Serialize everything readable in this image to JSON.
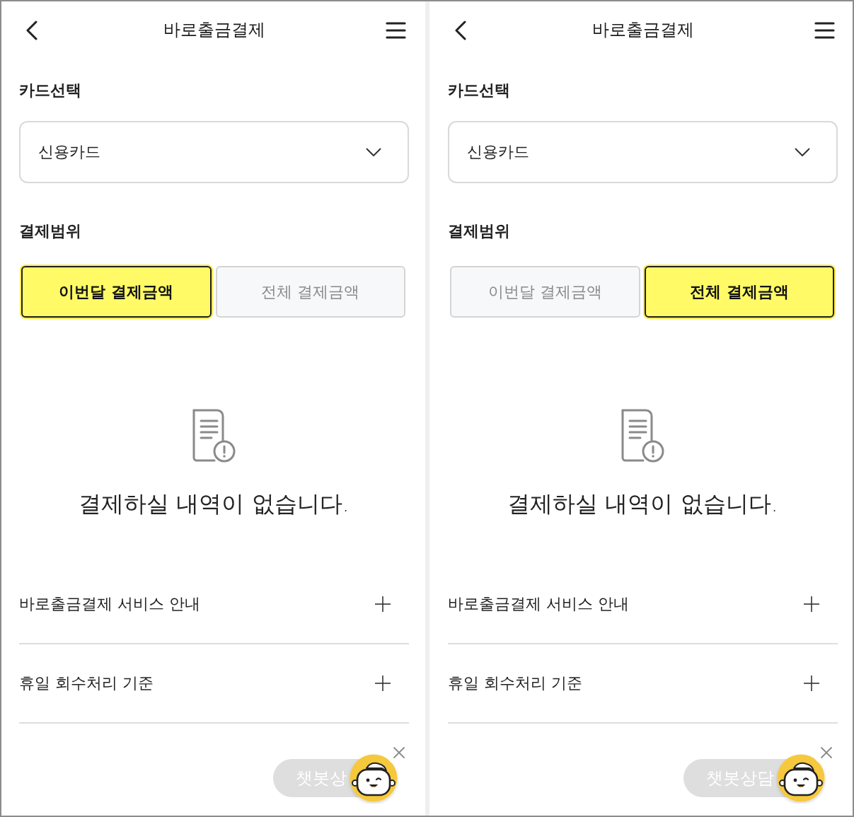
{
  "screens": [
    {
      "header": {
        "title": "바로출금결제"
      },
      "card_select": {
        "label": "카드선택",
        "value": "신용카드"
      },
      "payment_range": {
        "label": "결제범위",
        "options": [
          {
            "label": "이번달 결제금액",
            "selected": true
          },
          {
            "label": "전체 결제금액",
            "selected": false
          }
        ]
      },
      "empty_state": {
        "message": "결제하실 내역이 없습니다."
      },
      "accordion": [
        {
          "title": "바로출금결제 서비스 안내",
          "expanded": false
        },
        {
          "title": "휴일 회수처리 기준",
          "expanded": false
        }
      ],
      "chatbot": {
        "label": "챗봇상"
      }
    },
    {
      "header": {
        "title": "바로출금결제"
      },
      "card_select": {
        "label": "카드선택",
        "value": "신용카드"
      },
      "payment_range": {
        "label": "결제범위",
        "options": [
          {
            "label": "이번달 결제금액",
            "selected": false
          },
          {
            "label": "전체 결제금액",
            "selected": true
          }
        ]
      },
      "empty_state": {
        "message": "결제하실 내역이 없습니다."
      },
      "accordion": [
        {
          "title": "바로출금결제 서비스 안내",
          "expanded": false
        },
        {
          "title": "휴일 회수처리 기준",
          "expanded": false
        }
      ],
      "chatbot": {
        "label": "챗봇상담"
      }
    }
  ]
}
